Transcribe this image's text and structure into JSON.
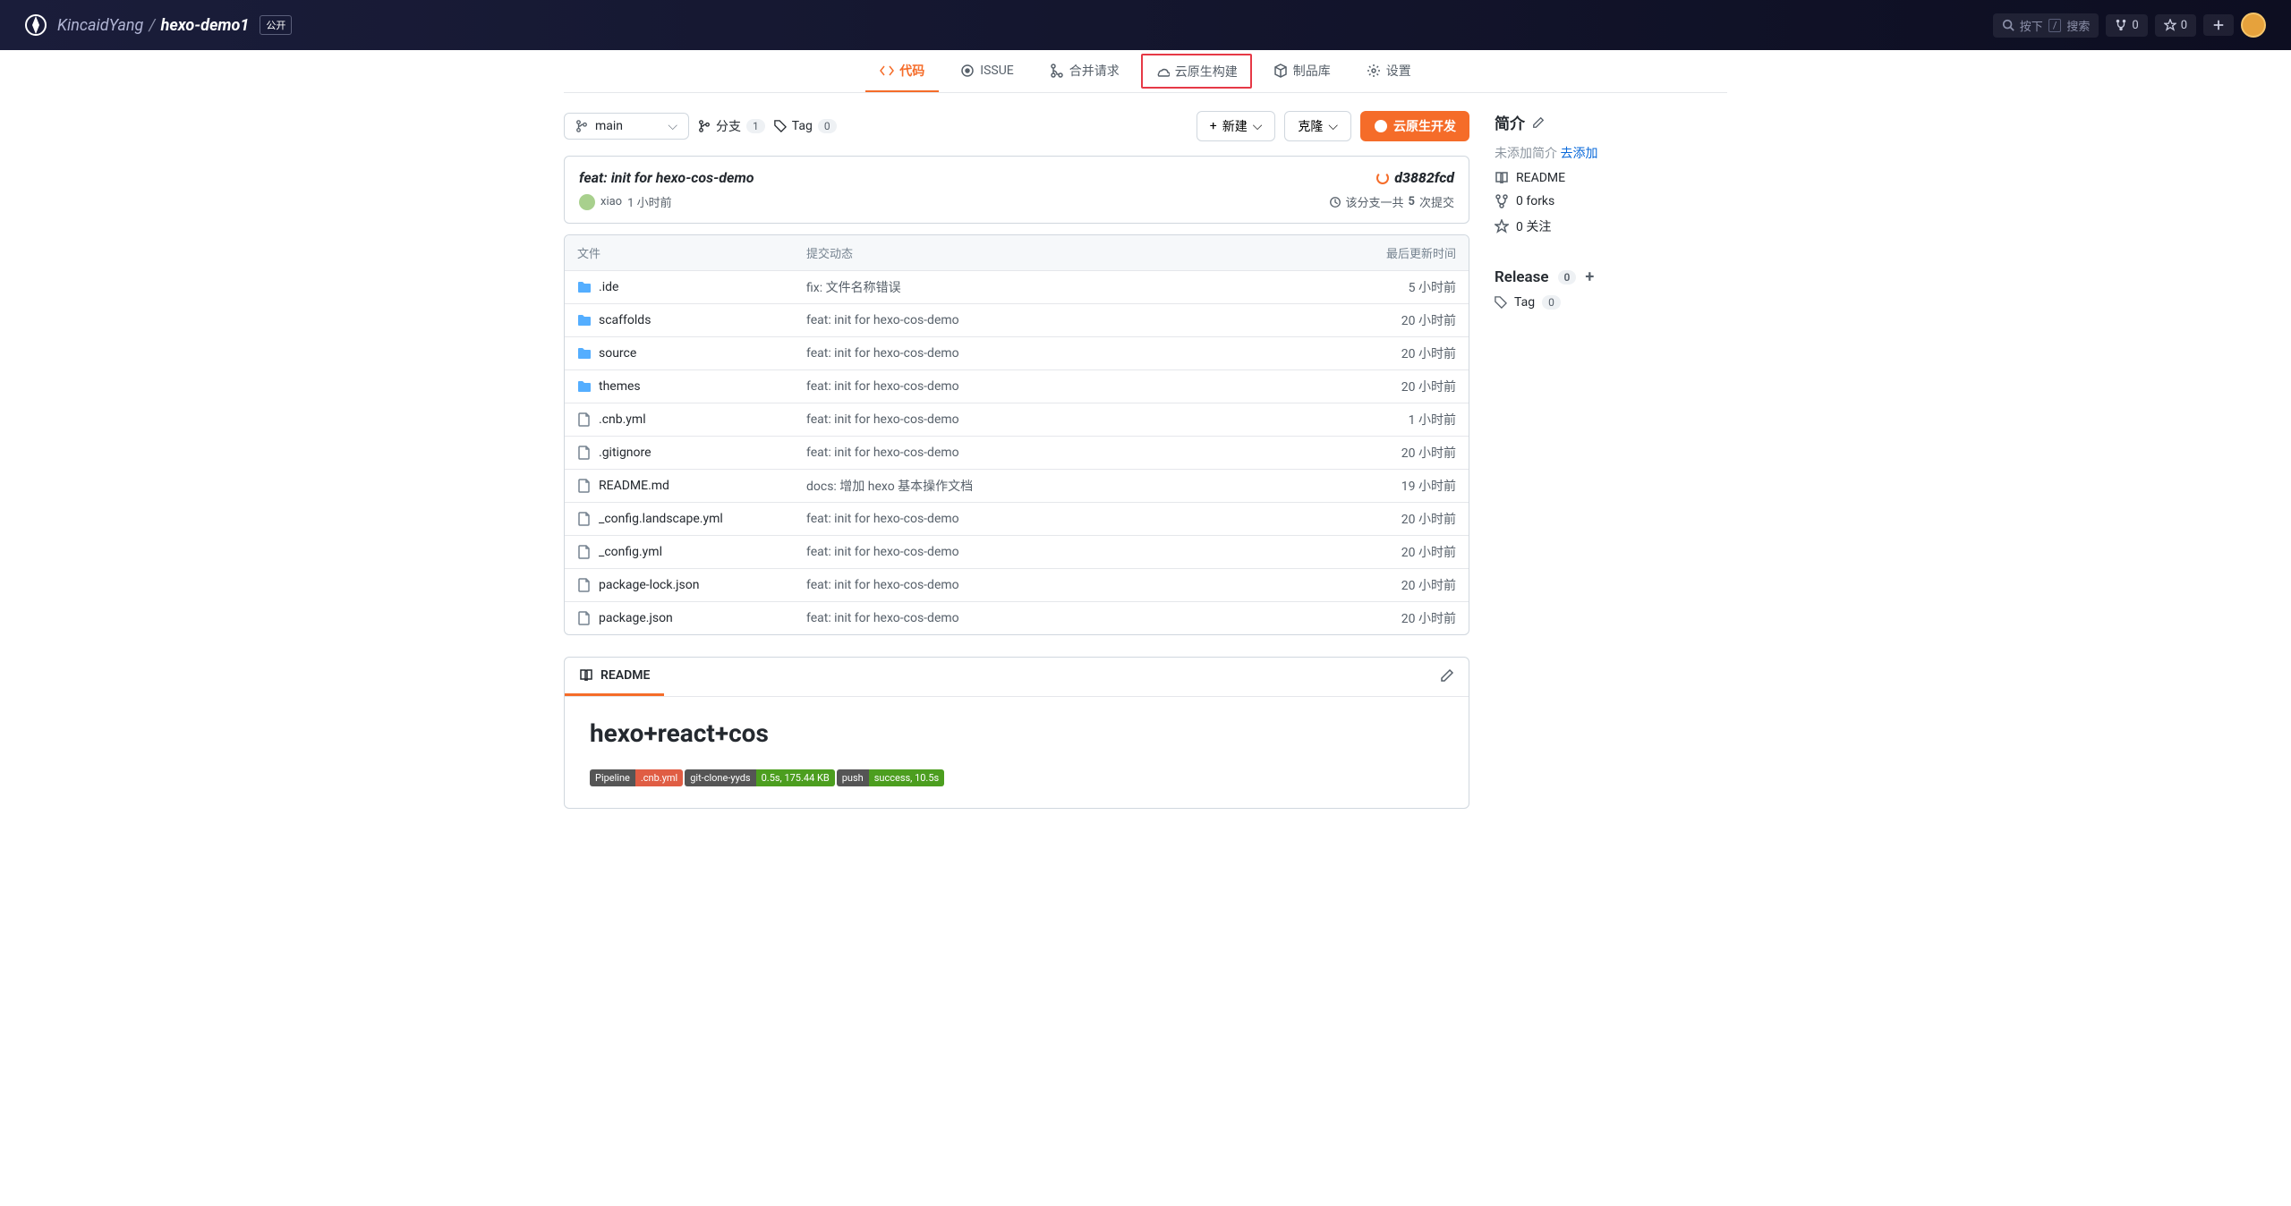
{
  "header": {
    "owner": "KincaidYang",
    "repo": "hexo-demo1",
    "visibility": "公开",
    "search_prompt": "按下",
    "search_label": "搜索",
    "fork_count": "0",
    "star_count": "0"
  },
  "tabs": {
    "code": "代码",
    "issue": "ISSUE",
    "merge": "合并请求",
    "cloud_build": "云原生构建",
    "packages": "制品库",
    "settings": "设置"
  },
  "toolbar": {
    "branch": "main",
    "branches_label": "分支",
    "branches_count": "1",
    "tag_label": "Tag",
    "tag_count": "0",
    "new_btn": "新建",
    "clone_btn": "克隆",
    "cloud_dev_btn": "云原生开发"
  },
  "commit": {
    "title": "feat: init for hexo-cos-demo",
    "author": "xiao",
    "author_time": "1 小时前",
    "hash": "d3882fcd",
    "total_prefix": "该分支一共",
    "total_count": "5",
    "total_suffix": "次提交"
  },
  "files": {
    "header_name": "文件",
    "header_msg": "提交动态",
    "header_time": "最后更新时间",
    "rows": [
      {
        "type": "folder",
        "name": ".ide",
        "msg": "fix: 文件名称错误",
        "time": "5 小时前"
      },
      {
        "type": "folder",
        "name": "scaffolds",
        "msg": "feat: init for hexo-cos-demo",
        "time": "20 小时前"
      },
      {
        "type": "folder",
        "name": "source",
        "msg": "feat: init for hexo-cos-demo",
        "time": "20 小时前"
      },
      {
        "type": "folder",
        "name": "themes",
        "msg": "feat: init for hexo-cos-demo",
        "time": "20 小时前"
      },
      {
        "type": "file",
        "name": ".cnb.yml",
        "msg": "feat: init for hexo-cos-demo",
        "time": "1 小时前"
      },
      {
        "type": "file",
        "name": ".gitignore",
        "msg": "feat: init for hexo-cos-demo",
        "time": "20 小时前"
      },
      {
        "type": "file",
        "name": "README.md",
        "msg": "docs: 增加 hexo 基本操作文档",
        "time": "19 小时前"
      },
      {
        "type": "file",
        "name": "_config.landscape.yml",
        "msg": "feat: init for hexo-cos-demo",
        "time": "20 小时前"
      },
      {
        "type": "file",
        "name": "_config.yml",
        "msg": "feat: init for hexo-cos-demo",
        "time": "20 小时前"
      },
      {
        "type": "file",
        "name": "package-lock.json",
        "msg": "feat: init for hexo-cos-demo",
        "time": "20 小时前"
      },
      {
        "type": "file",
        "name": "package.json",
        "msg": "feat: init for hexo-cos-demo",
        "time": "20 小时前"
      }
    ]
  },
  "readme": {
    "tab": "README",
    "title": "hexo+react+cos",
    "badges": [
      [
        {
          "text": "Pipeline",
          "bg": "#555"
        },
        {
          "text": ".cnb.yml",
          "bg": "#e05d44"
        }
      ],
      [
        {
          "text": "git-clone-yyds",
          "bg": "#555"
        },
        {
          "text": "0.5s, 175.44 KB",
          "bg": "#4c9e1f"
        }
      ],
      [
        {
          "text": "push",
          "bg": "#555"
        },
        {
          "text": "success, 10.5s",
          "bg": "#4c9e1f"
        }
      ]
    ]
  },
  "sidebar": {
    "intro_title": "简介",
    "no_desc": "未添加简介",
    "add_link": "去添加",
    "readme_link": "README",
    "forks": "0 forks",
    "watch": "0 关注",
    "release_title": "Release",
    "release_count": "0",
    "tag_label": "Tag",
    "tag_count": "0"
  }
}
